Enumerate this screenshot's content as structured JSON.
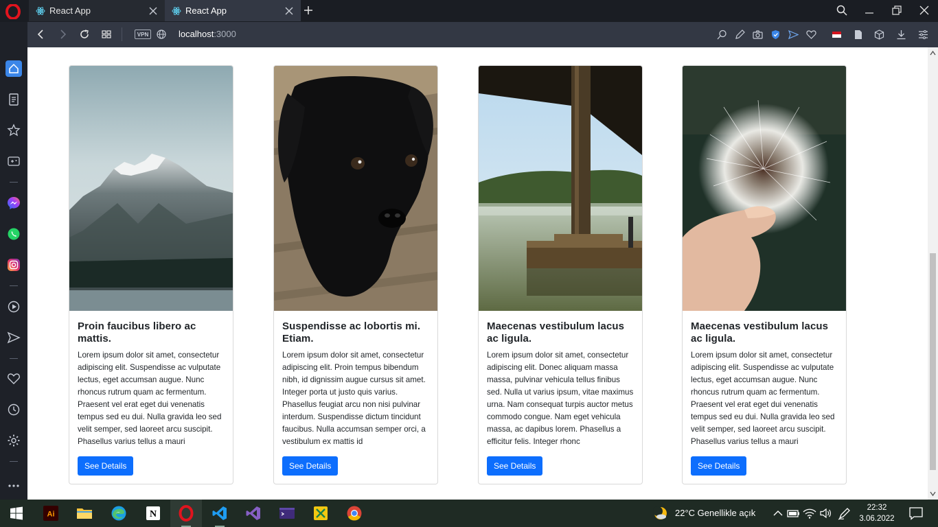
{
  "browser": {
    "tabs": [
      {
        "title": "React App",
        "active": false
      },
      {
        "title": "React App",
        "active": true
      }
    ],
    "address": {
      "host": "localhost",
      "port": ":3000"
    },
    "vpn_label": "VPN"
  },
  "cards": [
    {
      "image_alt": "snow-capped mountain over a lake",
      "title": "Proin faucibus libero ac mattis.",
      "text": "Lorem ipsum dolor sit amet, consectetur adipiscing elit. Suspendisse ac vulputate lectus, eget accumsan augue. Nunc rhoncus rutrum quam ac fermentum. Praesent vel erat eget dui venenatis tempus sed eu dui. Nulla gravida leo sed velit semper, sed laoreet arcu suscipit. Phasellus varius tellus a mauri",
      "button": "See Details"
    },
    {
      "image_alt": "black puppy on a wooden floor",
      "title": "Suspendisse ac lobortis mi. Etiam.",
      "text": "Lorem ipsum dolor sit amet, consectetur adipiscing elit. Proin tempus bibendum nibh, id dignissim augue cursus sit amet. Integer porta ut justo quis varius. Phasellus feugiat arcu non nisi pulvinar interdum. Suspendisse dictum tincidunt faucibus. Nulla accumsan semper orci, a vestibulum ex mattis id",
      "button": "See Details"
    },
    {
      "image_alt": "wooden dock on a misty lake",
      "title": "Maecenas vestibulum lacus ac ligula.",
      "text": "Lorem ipsum dolor sit amet, consectetur adipiscing elit. Donec aliquam massa massa, pulvinar vehicula tellus finibus sed. Nulla ut varius ipsum, vitae maximus urna. Nam consequat turpis auctor metus commodo congue. Nam eget vehicula massa, ac dapibus lorem. Phasellus a efficitur felis. Integer rhonc",
      "button": "See Details"
    },
    {
      "image_alt": "hand holding a dandelion",
      "title": "Maecenas vestibulum lacus ac ligula.",
      "text": "Lorem ipsum dolor sit amet, consectetur adipiscing elit. Suspendisse ac vulputate lectus, eget accumsan augue. Nunc rhoncus rutrum quam ac fermentum. Praesent vel erat eget dui venenatis tempus sed eu dui. Nulla gravida leo sed velit semper, sed laoreet arcu suscipit. Phasellus varius tellus a mauri",
      "button": "See Details"
    }
  ],
  "taskbar": {
    "weather": "22°C  Genellikle açık",
    "time": "22:32",
    "date": "3.06.2022"
  },
  "colors": {
    "primary_button": "#0d6efd",
    "opera_red": "#e0141e",
    "sidebar_active": "#3b86e8"
  }
}
